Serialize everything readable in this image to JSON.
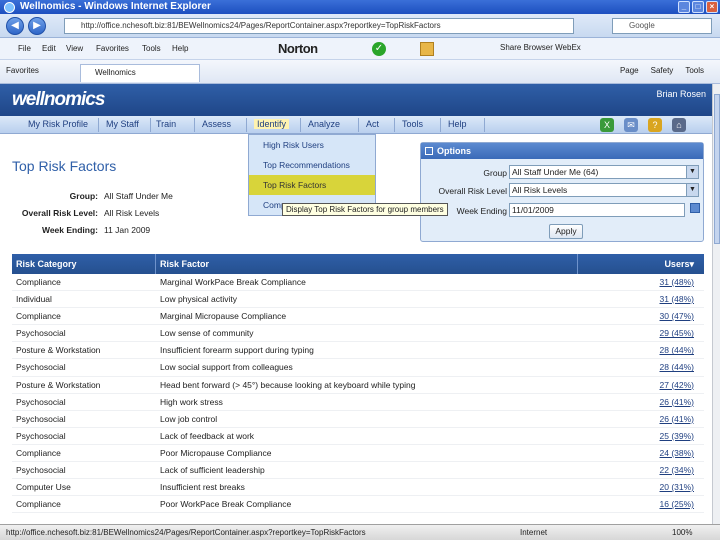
{
  "browser": {
    "title": "Wellnomics - Windows Internet Explorer",
    "address": "http://office.nchesoft.biz:81/BEWellnomics24/Pages/ReportContainer.aspx?reportkey=TopRiskFactors",
    "search_placeholder": "Google",
    "menu": [
      "File",
      "Edit",
      "View",
      "Favorites",
      "Tools",
      "Help"
    ],
    "norton": "Norton",
    "share": "Share Browser  WebEx",
    "favorites_label": "Favorites",
    "tab_label": "Wellnomics",
    "right_tools": [
      "Page",
      "Safety",
      "Tools"
    ],
    "status_url": "http://office.nchesoft.biz:81/BEWellnomics24/Pages/ReportContainer.aspx?reportkey=TopRiskFactors",
    "status_zone": "Internet",
    "status_zoom": "100%"
  },
  "app": {
    "logo": "wellnomics",
    "user": "Brian Rosen",
    "nav": [
      "My Risk Profile",
      "My Staff",
      "Train",
      "Assess",
      "Identify",
      "Analyze",
      "Act",
      "Tools",
      "Help"
    ],
    "identify_menu": [
      "High Risk Users",
      "Top Recommendations",
      "Top Risk Factors",
      "Compare"
    ],
    "tooltip": "Display Top Risk Factors for group members",
    "page_title": "Top Risk Factors",
    "summary": [
      {
        "label": "Group:",
        "value": "All Staff Under Me"
      },
      {
        "label": "Overall Risk Level:",
        "value": "All Risk Levels"
      },
      {
        "label": "Week Ending:",
        "value": "11 Jan 2009"
      }
    ],
    "options": {
      "title": "Options",
      "group_label": "Group",
      "group_value": "All Staff Under Me (64)",
      "risk_label": "Overall Risk Level",
      "risk_value": "All Risk Levels",
      "week_label": "Week Ending",
      "week_value": "11/01/2009",
      "apply": "Apply"
    },
    "table": {
      "headers": [
        "Risk Category",
        "Risk Factor",
        "Users"
      ],
      "rows": [
        [
          "Compliance",
          "Marginal WorkPace Break Compliance",
          "31 (48%)"
        ],
        [
          "Individual",
          "Low physical activity",
          "31 (48%)"
        ],
        [
          "Compliance",
          "Marginal Micropause Compliance",
          "30 (47%)"
        ],
        [
          "Psychosocial",
          "Low sense of community",
          "29 (45%)"
        ],
        [
          "Posture & Workstation",
          "Insufficient forearm support during typing",
          "28 (44%)"
        ],
        [
          "Psychosocial",
          "Low social support from colleagues",
          "28 (44%)"
        ],
        [
          "Posture & Workstation",
          "Head bent forward (> 45°) because looking at keyboard while typing",
          "27 (42%)"
        ],
        [
          "Psychosocial",
          "High work stress",
          "26 (41%)"
        ],
        [
          "Psychosocial",
          "Low job control",
          "26 (41%)"
        ],
        [
          "Psychosocial",
          "Lack of feedback at work",
          "25 (39%)"
        ],
        [
          "Compliance",
          "Poor Micropause Compliance",
          "24 (38%)"
        ],
        [
          "Psychosocial",
          "Lack of sufficient leadership",
          "22 (34%)"
        ],
        [
          "Computer Use",
          "Insufficient rest breaks",
          "20 (31%)"
        ],
        [
          "Compliance",
          "Poor WorkPace Break Compliance",
          "16 (25%)"
        ]
      ]
    }
  }
}
